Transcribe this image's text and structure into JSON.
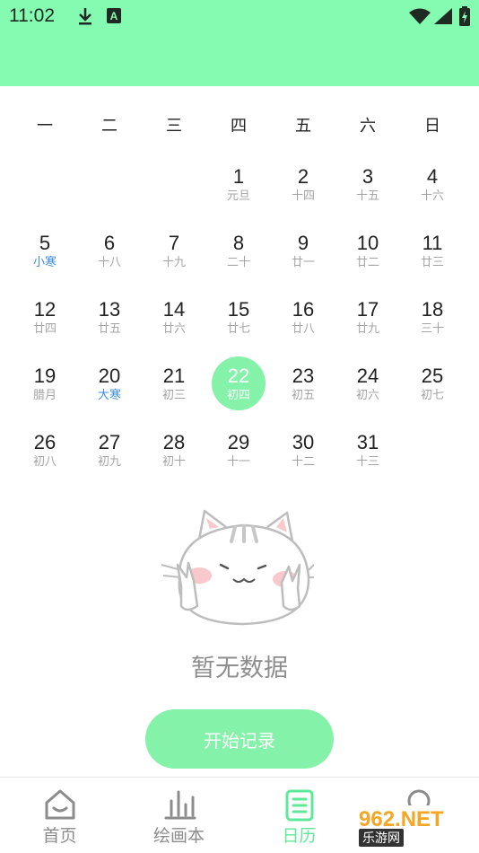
{
  "status_bar": {
    "time": "11:02",
    "icons": [
      "download-icon",
      "a-notification-icon",
      "wifi-icon",
      "signal-icon",
      "battery-charging-icon"
    ]
  },
  "calendar": {
    "weekdays": [
      "一",
      "二",
      "三",
      "四",
      "五",
      "六",
      "日"
    ],
    "first_weekday_index": 3,
    "selected_day": 22,
    "days": [
      {
        "d": "1",
        "sub": "元旦",
        "term": false
      },
      {
        "d": "2",
        "sub": "十四",
        "term": false
      },
      {
        "d": "3",
        "sub": "十五",
        "term": false
      },
      {
        "d": "4",
        "sub": "十六",
        "term": false
      },
      {
        "d": "5",
        "sub": "小寒",
        "term": true
      },
      {
        "d": "6",
        "sub": "十八",
        "term": false
      },
      {
        "d": "7",
        "sub": "十九",
        "term": false
      },
      {
        "d": "8",
        "sub": "二十",
        "term": false
      },
      {
        "d": "9",
        "sub": "廿一",
        "term": false
      },
      {
        "d": "10",
        "sub": "廿二",
        "term": false
      },
      {
        "d": "11",
        "sub": "廿三",
        "term": false
      },
      {
        "d": "12",
        "sub": "廿四",
        "term": false
      },
      {
        "d": "13",
        "sub": "廿五",
        "term": false
      },
      {
        "d": "14",
        "sub": "廿六",
        "term": false
      },
      {
        "d": "15",
        "sub": "廿七",
        "term": false
      },
      {
        "d": "16",
        "sub": "廿八",
        "term": false
      },
      {
        "d": "17",
        "sub": "廿九",
        "term": false
      },
      {
        "d": "18",
        "sub": "三十",
        "term": false
      },
      {
        "d": "19",
        "sub": "腊月",
        "term": false
      },
      {
        "d": "20",
        "sub": "大寒",
        "term": true
      },
      {
        "d": "21",
        "sub": "初三",
        "term": false
      },
      {
        "d": "22",
        "sub": "初四",
        "term": false
      },
      {
        "d": "23",
        "sub": "初五",
        "term": false
      },
      {
        "d": "24",
        "sub": "初六",
        "term": false
      },
      {
        "d": "25",
        "sub": "初七",
        "term": false
      },
      {
        "d": "26",
        "sub": "初八",
        "term": false
      },
      {
        "d": "27",
        "sub": "初九",
        "term": false
      },
      {
        "d": "28",
        "sub": "初十",
        "term": false
      },
      {
        "d": "29",
        "sub": "十一",
        "term": false
      },
      {
        "d": "30",
        "sub": "十二",
        "term": false
      },
      {
        "d": "31",
        "sub": "十三",
        "term": false
      }
    ]
  },
  "empty_state": {
    "illustration": "cat-illustration",
    "text": "暂无数据",
    "button_label": "开始记录"
  },
  "tabbar": {
    "tabs": [
      {
        "label": "首页",
        "icon": "home-icon"
      },
      {
        "label": "绘画本",
        "icon": "bar-chart-icon"
      },
      {
        "label": "日历",
        "icon": "calendar-note-icon"
      },
      {
        "label": "",
        "icon": "profile-icon"
      }
    ],
    "active_index": 2
  },
  "watermark": {
    "main": "962.NET",
    "sub": "乐游网"
  },
  "colors": {
    "accent": "#84fbb1",
    "button": "#84f2a9",
    "solar_term": "#3b8de0",
    "active_tab": "#5fe89a"
  }
}
